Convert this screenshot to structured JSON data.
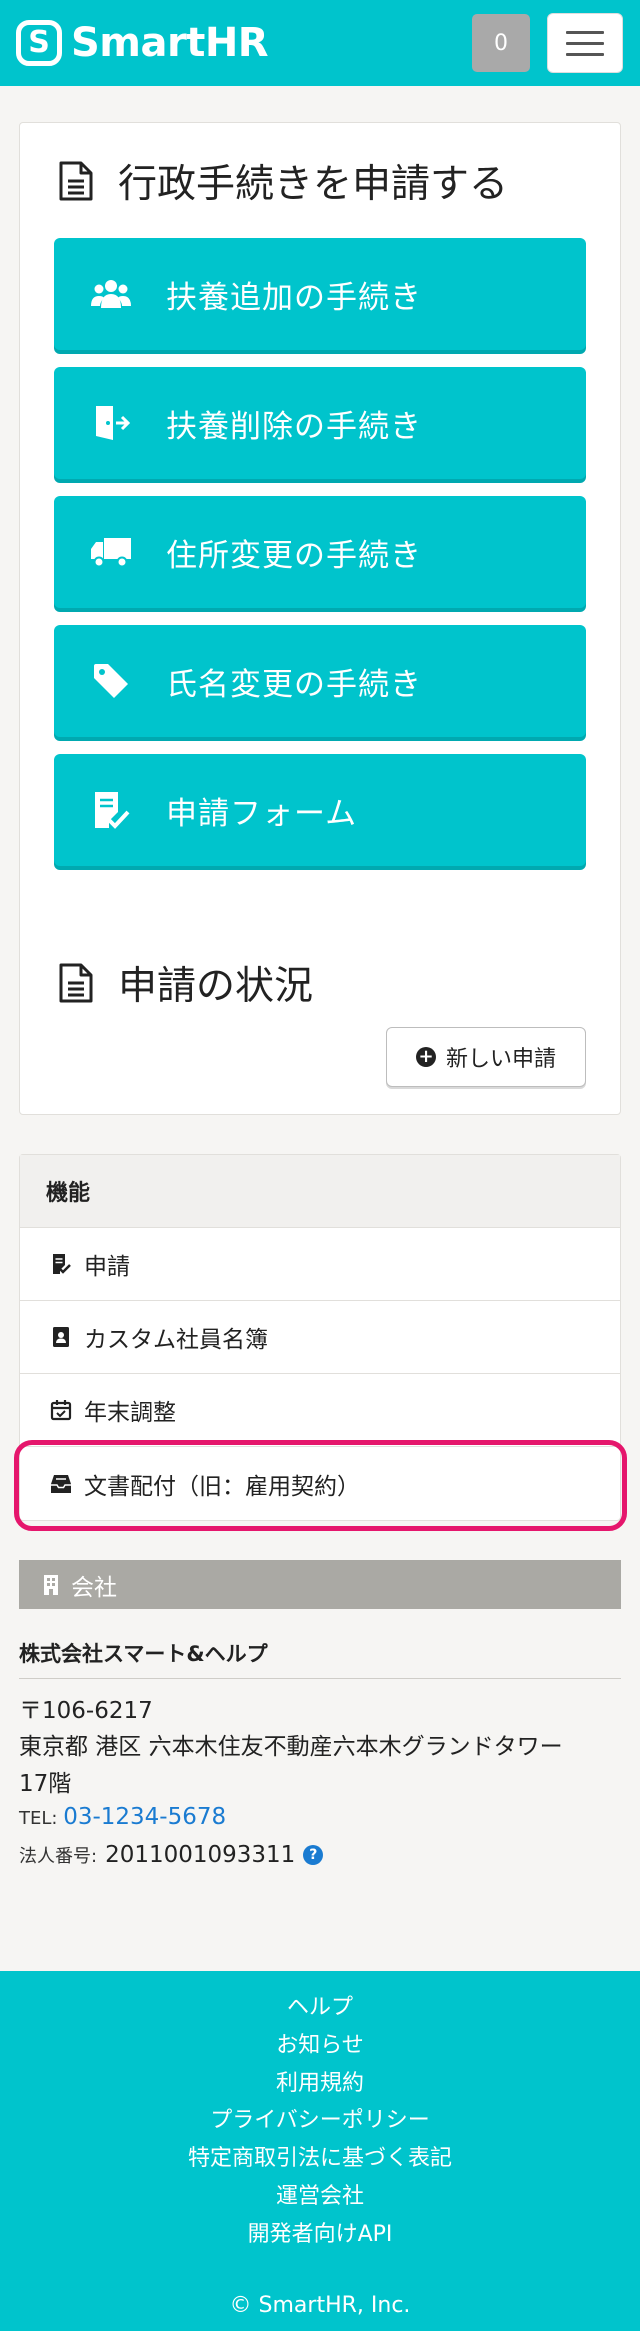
{
  "header": {
    "logo_text": "SmartHR",
    "notification_count": "0"
  },
  "procedures": {
    "title": "行政手続きを申請する",
    "buttons": [
      {
        "label": "扶養追加の手続き",
        "icon": "users-icon"
      },
      {
        "label": "扶養削除の手続き",
        "icon": "door-exit-icon"
      },
      {
        "label": "住所変更の手続き",
        "icon": "truck-icon"
      },
      {
        "label": "氏名変更の手続き",
        "icon": "tag-icon"
      },
      {
        "label": "申請フォーム",
        "icon": "form-check-icon"
      }
    ]
  },
  "status": {
    "title": "申請の状況",
    "new_button": "新しい申請"
  },
  "features": {
    "header": "機能",
    "items": [
      {
        "label": "申請",
        "icon": "form-check-icon"
      },
      {
        "label": "カスタム社員名簿",
        "icon": "id-card-icon"
      },
      {
        "label": "年末調整",
        "icon": "calendar-check-icon"
      },
      {
        "label": "文書配付（旧：雇用契約）",
        "icon": "inbox-icon"
      }
    ]
  },
  "company": {
    "section_label": "会社",
    "name": "株式会社スマート&ヘルプ",
    "postal": "〒106-6217",
    "address_line1": "東京都 港区 六本木住友不動産六本木グランドタワー",
    "address_line2": "17階",
    "tel_label": "TEL:",
    "tel": "03-1234-5678",
    "corp_number_label": "法人番号:",
    "corp_number": "2011001093311"
  },
  "footer": {
    "links": [
      "ヘルプ",
      "お知らせ",
      "利用規約",
      "プライバシーポリシー",
      "特定商取引法に基づく表記",
      "運営会社",
      "開発者向けAPI"
    ],
    "copyright": "© SmartHR, Inc."
  },
  "colors": {
    "brand": "#00c4cc",
    "highlight": "#e5166c",
    "link": "#1a7bd1"
  }
}
